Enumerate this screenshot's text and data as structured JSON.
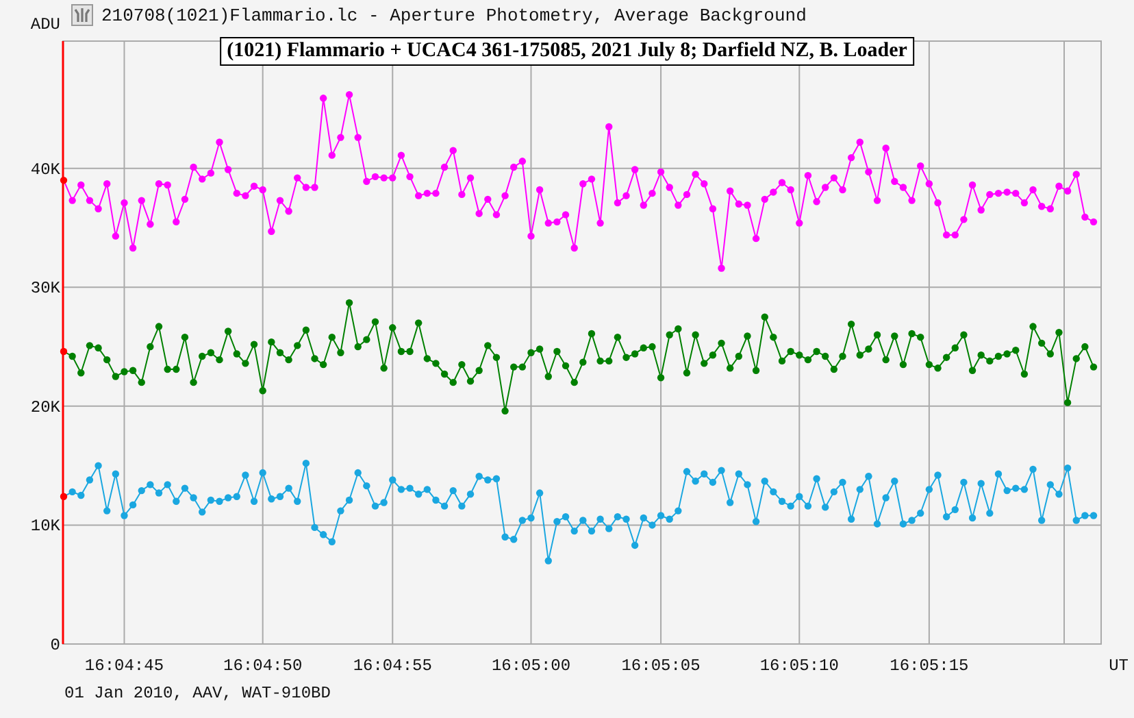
{
  "window": {
    "title": "210708(1021)Flammario.lc - Aperture Photometry, Average Background"
  },
  "chart": {
    "chart_data": {
      "type": "line",
      "title": "(1021) Flammario + UCAC4 361-175085, 2021 July 8; Darfield NZ, B. Loader",
      "xlabel": "UT",
      "ylabel": "ADU",
      "ylim": [
        0,
        50700
      ],
      "grid": true,
      "yticks": [
        {
          "value": 0,
          "label": "0"
        },
        {
          "value": 10000,
          "label": "10K"
        },
        {
          "value": 20000,
          "label": "20K"
        },
        {
          "value": 30000,
          "label": "30K"
        },
        {
          "value": 40000,
          "label": "40K"
        }
      ],
      "categories": [
        null,
        null,
        null,
        null,
        null,
        null,
        null,
        "16:04:45",
        null,
        null,
        null,
        null,
        null,
        null,
        null,
        null,
        null,
        null,
        null,
        null,
        null,
        null,
        null,
        "16:04:50",
        null,
        null,
        null,
        null,
        null,
        null,
        null,
        null,
        null,
        null,
        null,
        null,
        null,
        null,
        "16:04:55",
        null,
        null,
        null,
        null,
        null,
        null,
        null,
        null,
        null,
        null,
        null,
        null,
        null,
        null,
        null,
        "16:05:00",
        null,
        null,
        null,
        null,
        null,
        null,
        null,
        null,
        null,
        null,
        null,
        null,
        null,
        null,
        "16:05:05",
        null,
        null,
        null,
        null,
        null,
        null,
        null,
        null,
        null,
        null,
        null,
        null,
        null,
        null,
        null,
        "16:05:10",
        null,
        null,
        null,
        null,
        null,
        null,
        null,
        null,
        null,
        null,
        null,
        null,
        null,
        null,
        "16:05:15",
        null,
        null,
        null,
        null,
        null,
        null,
        null,
        null,
        null,
        null,
        null,
        null,
        null,
        null,
        null,
        null,
        null,
        null,
        null
      ],
      "series": [
        {
          "color": "#ff00ff",
          "marker": "circle",
          "values": [
            39000,
            37300,
            38600,
            37300,
            36600,
            38700,
            34300,
            37100,
            33300,
            37300,
            35300,
            38700,
            38600,
            35500,
            37400,
            40100,
            39100,
            39600,
            42200,
            39900,
            37900,
            37700,
            38500,
            38200,
            34700,
            37300,
            36400,
            39200,
            38400,
            38400,
            45900,
            41100,
            42600,
            46200,
            42600,
            38900,
            39300,
            39200,
            39200,
            41100,
            39300,
            37700,
            37900,
            37900,
            40100,
            41500,
            37800,
            39200,
            36200,
            37400,
            36100,
            37700,
            40100,
            40600,
            34300,
            38200,
            35400,
            35500,
            36100,
            33300,
            38700,
            39100,
            35400,
            43500,
            37100,
            37700,
            39900,
            36900,
            37900,
            39700,
            38400,
            36900,
            37800,
            39500,
            38700,
            36600,
            31600,
            38100,
            37000,
            36900,
            34100,
            37400,
            38000,
            38800,
            38200,
            35400,
            39400,
            37200,
            38400,
            39200,
            38200,
            40900,
            42200,
            39700,
            37300,
            41700,
            38900,
            38400,
            37300,
            40200,
            38700,
            37100,
            34400,
            34400,
            35700,
            38600,
            36500,
            37800,
            37900,
            38000,
            37900,
            37100,
            38200,
            36800,
            36600,
            38500,
            38100,
            39500,
            35900,
            35500
          ]
        },
        {
          "color": "#008000",
          "marker": "circle",
          "values": [
            24600,
            24200,
            22800,
            25100,
            24900,
            23900,
            22500,
            22900,
            23000,
            22000,
            25000,
            26700,
            23100,
            23100,
            25800,
            22000,
            24200,
            24500,
            23900,
            26300,
            24400,
            23600,
            25200,
            21300,
            25400,
            24500,
            23900,
            25100,
            26400,
            24000,
            23500,
            25800,
            24500,
            28700,
            25000,
            25600,
            27100,
            23200,
            26600,
            24600,
            24600,
            27000,
            24000,
            23600,
            22700,
            22000,
            23500,
            22100,
            23000,
            25100,
            24100,
            19600,
            23300,
            23300,
            24500,
            24800,
            22500,
            24600,
            23400,
            22000,
            23700,
            26100,
            23800,
            23800,
            25800,
            24100,
            24400,
            24900,
            25000,
            22400,
            26000,
            26500,
            22800,
            26000,
            23600,
            24300,
            25300,
            23200,
            24200,
            25900,
            23000,
            27500,
            25800,
            23800,
            24600,
            24300,
            23900,
            24600,
            24200,
            23100,
            24200,
            26900,
            24300,
            24800,
            26000,
            23900,
            25900,
            23500,
            26100,
            25800,
            23500,
            23200,
            24100,
            24900,
            26000,
            23000,
            24300,
            23800,
            24200,
            24400,
            24700,
            22700,
            26700,
            25300,
            24400,
            26200,
            20300,
            24000,
            25000,
            23300
          ]
        },
        {
          "color": "#1aa7e0",
          "marker": "circle",
          "values": [
            12400,
            12800,
            12500,
            13800,
            15000,
            11200,
            14300,
            10800,
            11700,
            12900,
            13400,
            12700,
            13400,
            12000,
            13100,
            12300,
            11100,
            12100,
            12000,
            12300,
            12400,
            14200,
            12000,
            14400,
            12200,
            12400,
            13100,
            12000,
            15200,
            9800,
            9200,
            8600,
            11200,
            12100,
            14400,
            13300,
            11600,
            11900,
            13800,
            13000,
            13100,
            12600,
            13000,
            12100,
            11600,
            12900,
            11600,
            12600,
            14100,
            13800,
            13900,
            9000,
            8800,
            10400,
            10600,
            12700,
            7000,
            10300,
            10700,
            9500,
            10400,
            9500,
            10500,
            9700,
            10700,
            10500,
            8300,
            10600,
            10000,
            10800,
            10500,
            11200,
            14500,
            13700,
            14300,
            13600,
            14600,
            11900,
            14300,
            13400,
            10300,
            13700,
            12800,
            12000,
            11600,
            12400,
            11600,
            13900,
            11500,
            12800,
            13600,
            10500,
            13000,
            14100,
            10100,
            12300,
            13700,
            10100,
            10400,
            11000,
            13000,
            14200,
            10700,
            11300,
            13600,
            10600,
            13500,
            11000,
            14300,
            12900,
            13100,
            13000,
            14700,
            10400,
            13400,
            12600,
            14800,
            10400,
            10800,
            10800
          ]
        }
      ]
    }
  },
  "footer": "01 Jan 2010, AAV, WAT-910BD"
}
